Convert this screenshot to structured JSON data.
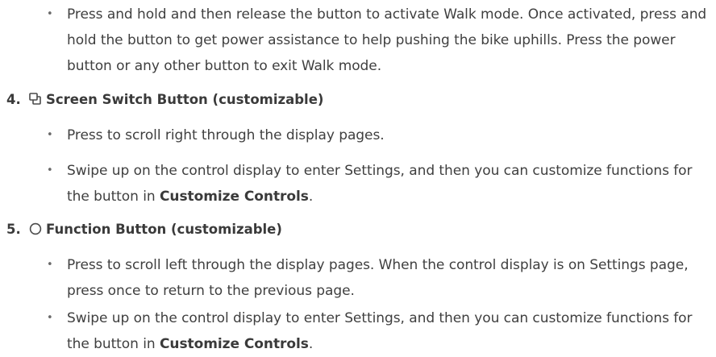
{
  "colors": {
    "text": "#3f3f3f",
    "heading": "#3a3a3a"
  },
  "walk_mode": {
    "text": "Press and hold and then release the button to activate Walk mode. Once activated, press and hold the button to get power assistance to help pushing the bike uphills. Press the power button or any other button to exit Walk mode."
  },
  "screen_switch": {
    "number": "4.",
    "icon": "screen-switch-icon",
    "title": "Screen Switch Button (customizable)",
    "bullets": [
      {
        "text": "Press to scroll right through the display pages."
      },
      {
        "text": "Swipe up on the control display to enter Settings, and then you can customize functions for the button in ",
        "bold": "Customize Controls",
        "end": "."
      }
    ]
  },
  "function_button": {
    "number": "5.",
    "icon": "circle-icon",
    "title": "Function Button (customizable)",
    "bullets": [
      {
        "text": "Press to scroll left through the display pages. When the control display is on Settings page, press once to return to the previous page."
      },
      {
        "text": "Swipe up on the control display to enter Settings, and then you can customize functions for the button in ",
        "bold": "Customize Controls",
        "end": "."
      }
    ]
  }
}
